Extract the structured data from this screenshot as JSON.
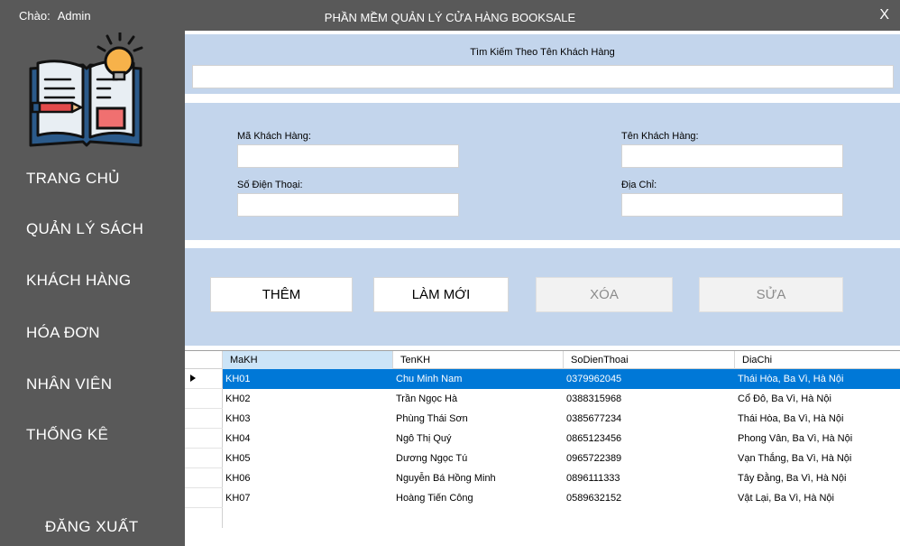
{
  "header": {
    "greeting": "Chào:",
    "user": "Admin",
    "title": "PHẦN MỀM QUẢN LÝ CỬA HÀNG BOOKSALE",
    "close": "X"
  },
  "sidebar": {
    "logo_icon": "open-book-lightbulb-icon",
    "items": [
      {
        "label": "TRANG CHỦ"
      },
      {
        "label": "QUẢN LÝ SÁCH"
      },
      {
        "label": "KHÁCH HÀNG"
      },
      {
        "label": "HÓA ĐƠN"
      },
      {
        "label": "NHÂN VIÊN"
      },
      {
        "label": "THỐNG KÊ"
      }
    ],
    "logout": "ĐĂNG  XUẤT"
  },
  "search": {
    "label": "Tìm Kiếm Theo Tên Khách Hàng",
    "value": ""
  },
  "form": {
    "ma_label": "Mã Khách Hàng:",
    "ma_value": "",
    "ten_label": "Tên Khách Hàng:",
    "ten_value": "",
    "sdt_label": "Số Điện Thoại:",
    "sdt_value": "",
    "diachi_label": "Địa Chỉ:",
    "diachi_value": ""
  },
  "buttons": {
    "them": "THÊM",
    "lammoi": "LÀM MỚI",
    "xoa": "XÓA",
    "sua": "SỬA"
  },
  "grid": {
    "columns": [
      "MaKH",
      "TenKH",
      "SoDienThoai",
      "DiaChi"
    ],
    "rows": [
      [
        "KH01",
        "Chu Minh Nam",
        "0379962045",
        "Thái Hòa, Ba Vì, Hà Nội"
      ],
      [
        "KH02",
        "Trần Ngọc Hà",
        "0388315968",
        "Cổ Đô, Ba Vì, Hà Nội"
      ],
      [
        "KH03",
        "Phùng Thái Sơn",
        "0385677234",
        "Thái Hòa, Ba Vì, Hà Nội"
      ],
      [
        "KH04",
        "Ngô Thị Quý",
        "0865123456",
        "Phong Vân, Ba Vì, Hà Nội"
      ],
      [
        "KH05",
        "Dương Ngọc Tú",
        "0965722389",
        "Vạn Thắng, Ba Vì, Hà Nội"
      ],
      [
        "KH06",
        "Nguyễn Bá Hồng Minh",
        "0896111333",
        "Tây Đằng, Ba Vì, Hà Nội"
      ],
      [
        "KH07",
        "Hoàng Tiến Công",
        "0589632152",
        "Vật Lại, Ba Vì, Hà Nội"
      ]
    ],
    "selected_row": 0
  },
  "colors": {
    "background": "#595959",
    "panel": "#c3d5ec",
    "selection": "#0078d7"
  }
}
